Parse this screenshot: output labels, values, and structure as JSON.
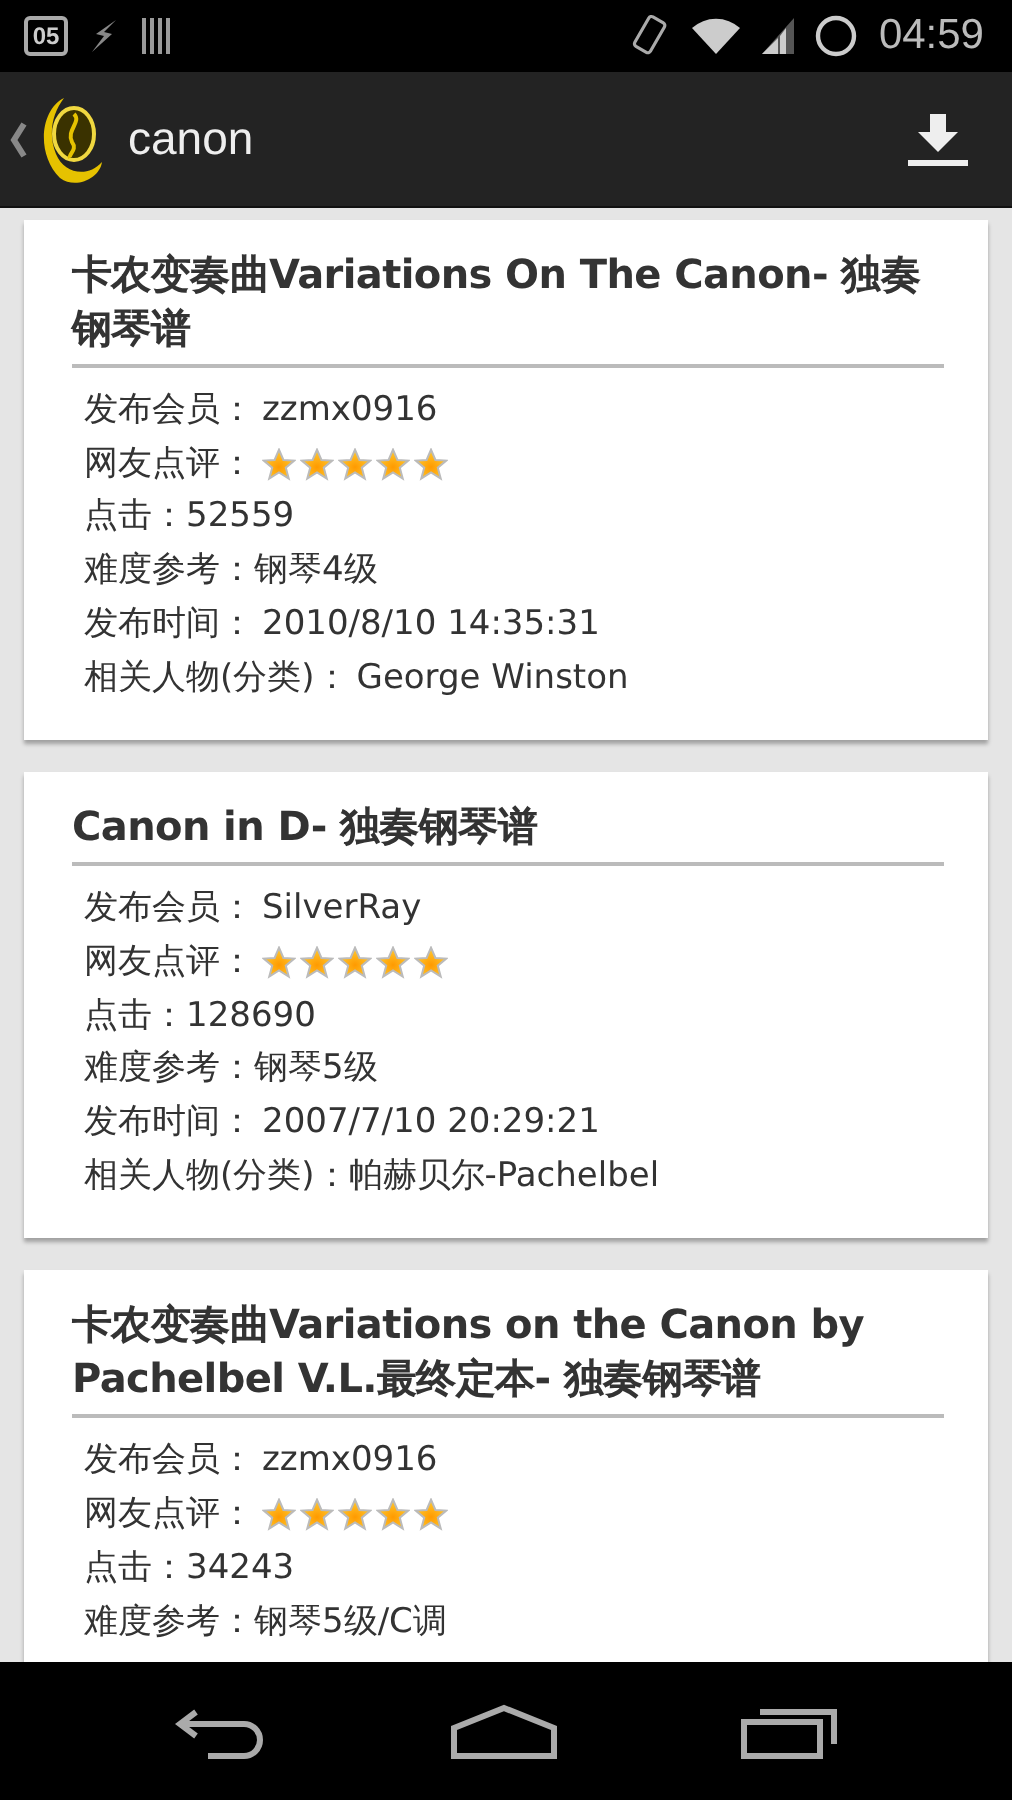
{
  "status_bar": {
    "calendar_day": "05",
    "time": "04:59"
  },
  "action_bar": {
    "title": "canon"
  },
  "cards": [
    {
      "title": "卡农变奏曲Variations On The Canon- 独奏钢琴谱",
      "fields": [
        {
          "kind": "text",
          "label": "发布会员：",
          "value": "zzmx0916"
        },
        {
          "kind": "rating",
          "label": "网友点评：",
          "stars": 5
        },
        {
          "kind": "text",
          "label": "点击：",
          "value": "52559"
        },
        {
          "kind": "text",
          "label": "难度参考：",
          "value": "钢琴4级"
        },
        {
          "kind": "text",
          "label": "发布时间：",
          "value": "2010/8/10 14:35:31"
        },
        {
          "kind": "text",
          "label": "相关人物(分类)：",
          "value": "George Winston"
        }
      ]
    },
    {
      "title": "Canon in D- 独奏钢琴谱",
      "fields": [
        {
          "kind": "text",
          "label": "发布会员：",
          "value": "SilverRay"
        },
        {
          "kind": "rating",
          "label": "网友点评：",
          "stars": 5
        },
        {
          "kind": "text",
          "label": "点击：",
          "value": "128690"
        },
        {
          "kind": "text",
          "label": "难度参考：",
          "value": "钢琴5级"
        },
        {
          "kind": "text",
          "label": "发布时间：",
          "value": "2007/7/10 20:29:21"
        },
        {
          "kind": "text",
          "label": "相关人物(分类)：",
          "value": "帕赫贝尔-Pachelbel"
        }
      ]
    },
    {
      "title": "卡农变奏曲Variations on the Canon by Pachelbel V.L.最终定本- 独奏钢琴谱",
      "fields": [
        {
          "kind": "text",
          "label": "发布会员：",
          "value": "zzmx0916"
        },
        {
          "kind": "rating",
          "label": "网友点评：",
          "stars": 5
        },
        {
          "kind": "text",
          "label": "点击：",
          "value": "34243"
        },
        {
          "kind": "text",
          "label": "难度参考：",
          "value": "钢琴5级/C调"
        }
      ]
    }
  ]
}
